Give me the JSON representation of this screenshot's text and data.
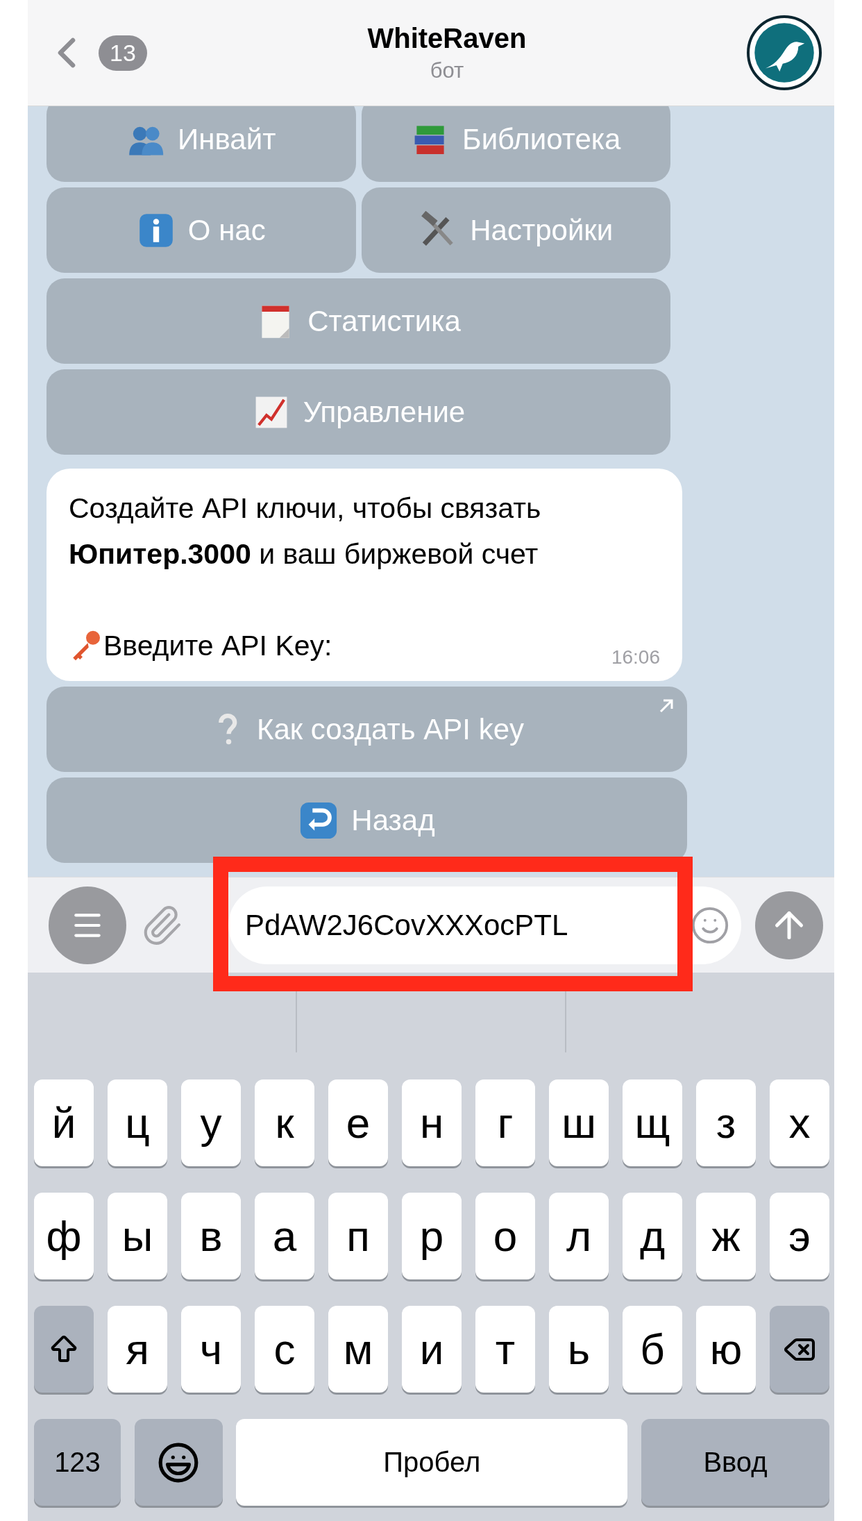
{
  "header": {
    "back_count": "13",
    "title": "WhiteRaven",
    "subtitle": "бот"
  },
  "reply_keyboard": [
    [
      "Инвайт",
      "Библиотека"
    ],
    [
      "О нас",
      "Настройки"
    ],
    [
      "Статистика"
    ],
    [
      "Управление"
    ]
  ],
  "message": {
    "text": "Создайте API ключи, чтобы связать **Юпитер.3000** и ваш биржевой счет",
    "prompt": "Введите API Key:",
    "time": "16:06"
  },
  "inline_buttons": [
    {
      "label": "Как создать API key",
      "external": true
    },
    {
      "label": "Назад",
      "external": false
    }
  ],
  "input": {
    "value": "PdAW2J6CovXXXocPTL",
    "highlighted": true
  },
  "keyboard": {
    "rows": [
      [
        {
          "kind": "letter",
          "label": "й"
        },
        {
          "kind": "letter",
          "label": "ц"
        },
        {
          "kind": "letter",
          "label": "у"
        },
        {
          "kind": "letter",
          "label": "к"
        },
        {
          "kind": "letter",
          "label": "е"
        },
        {
          "kind": "letter",
          "label": "н"
        },
        {
          "kind": "letter",
          "label": "г"
        },
        {
          "kind": "letter",
          "label": "ш"
        },
        {
          "kind": "letter",
          "label": "щ"
        },
        {
          "kind": "letter",
          "label": "з"
        },
        {
          "kind": "letter",
          "label": "х"
        }
      ],
      [
        {
          "kind": "letter",
          "label": "ф"
        },
        {
          "kind": "letter",
          "label": "ы"
        },
        {
          "kind": "letter",
          "label": "в"
        },
        {
          "kind": "letter",
          "label": "а"
        },
        {
          "kind": "letter",
          "label": "п"
        },
        {
          "kind": "letter",
          "label": "р"
        },
        {
          "kind": "letter",
          "label": "о"
        },
        {
          "kind": "letter",
          "label": "л"
        },
        {
          "kind": "letter",
          "label": "д"
        },
        {
          "kind": "letter",
          "label": "ж"
        },
        {
          "kind": "letter",
          "label": "э"
        }
      ],
      [
        {
          "kind": "shift"
        },
        {
          "kind": "letter",
          "label": "я"
        },
        {
          "kind": "letter",
          "label": "ч"
        },
        {
          "kind": "letter",
          "label": "с"
        },
        {
          "kind": "letter",
          "label": "м"
        },
        {
          "kind": "letter",
          "label": "и"
        },
        {
          "kind": "letter",
          "label": "т"
        },
        {
          "kind": "letter",
          "label": "ь"
        },
        {
          "kind": "letter",
          "label": "б"
        },
        {
          "kind": "letter",
          "label": "ю"
        },
        {
          "kind": "delete"
        }
      ]
    ],
    "bottom_row": [
      {
        "kind": "numbers",
        "label": "123"
      },
      {
        "kind": "emoji"
      },
      {
        "kind": "space",
        "label": "Пробел"
      },
      {
        "kind": "return",
        "label": "Ввод"
      }
    ]
  }
}
